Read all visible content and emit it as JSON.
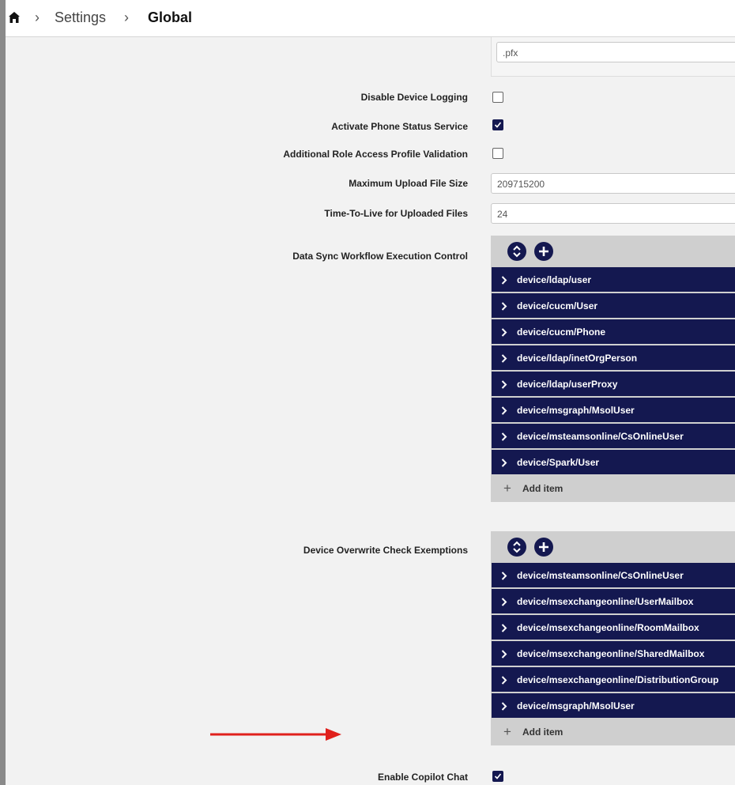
{
  "breadcrumb": {
    "settings": "Settings",
    "global": "Global"
  },
  "fields": {
    "pfx_value": ".pfx",
    "disable_device_logging": {
      "label": "Disable Device Logging",
      "checked": false
    },
    "activate_phone_status": {
      "label": "Activate Phone Status Service",
      "checked": true
    },
    "additional_role_access": {
      "label": "Additional Role Access Profile Validation",
      "checked": false
    },
    "max_upload_size": {
      "label": "Maximum Upload File Size",
      "value": "209715200"
    },
    "ttl_uploaded": {
      "label": "Time-To-Live for Uploaded Files",
      "value": "24"
    },
    "data_sync": {
      "label": "Data Sync Workflow Execution Control",
      "items": [
        "device/ldap/user",
        "device/cucm/User",
        "device/cucm/Phone",
        "device/ldap/inetOrgPerson",
        "device/ldap/userProxy",
        "device/msgraph/MsolUser",
        "device/msteamsonline/CsOnlineUser",
        "device/Spark/User"
      ],
      "add_label": "Add item"
    },
    "overwrite_exemptions": {
      "label": "Device Overwrite Check Exemptions",
      "items": [
        "device/msteamsonline/CsOnlineUser",
        "device/msexchangeonline/UserMailbox",
        "device/msexchangeonline/RoomMailbox",
        "device/msexchangeonline/SharedMailbox",
        "device/msexchangeonline/DistributionGroup",
        "device/msgraph/MsolUser"
      ],
      "add_label": "Add item"
    },
    "enable_copilot_chat": {
      "label": "Enable Copilot Chat",
      "checked": true
    }
  },
  "colors": {
    "navy": "#141850",
    "annotation_arrow": "#e0201c"
  },
  "icons": {
    "home": "home-icon",
    "breadcrumb_sep": "chevron-right-icon",
    "sort": "sort-icon",
    "add": "plus-circle-icon",
    "expand": "chevron-right-icon"
  }
}
